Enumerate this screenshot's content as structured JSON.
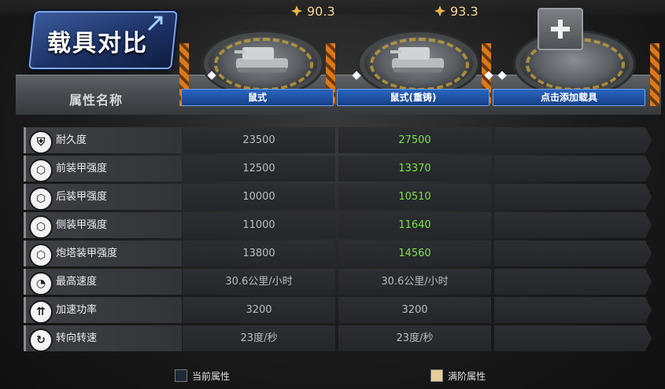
{
  "title": "载具对比",
  "header": {
    "attr_label": "属性名称"
  },
  "slots": [
    {
      "name": "鼠式",
      "rating": "90.3"
    },
    {
      "name": "鼠式(重铸)",
      "rating": "93.3"
    },
    {
      "name": "点击添加载具"
    }
  ],
  "rows": [
    {
      "icon": "durability-icon",
      "label": "耐久度",
      "current": "23500",
      "max": "27500"
    },
    {
      "icon": "armor-front-icon",
      "label": "前装甲强度",
      "current": "12500",
      "max": "13370"
    },
    {
      "icon": "armor-rear-icon",
      "label": "后装甲强度",
      "current": "10000",
      "max": "10510"
    },
    {
      "icon": "armor-side-icon",
      "label": "侧装甲强度",
      "current": "11000",
      "max": "11640"
    },
    {
      "icon": "armor-turret-icon",
      "label": "炮塔装甲强度",
      "current": "13800",
      "max": "14560"
    },
    {
      "icon": "speedometer-icon",
      "label": "最高速度",
      "current": "30.6公里/小时",
      "max": "30.6公里/小时"
    },
    {
      "icon": "acceleration-icon",
      "label": "加速功率",
      "current": "3200",
      "max": "3200"
    },
    {
      "icon": "turn-rate-icon",
      "label": "转向转速",
      "current": "23度/秒",
      "max": "23度/秒"
    }
  ],
  "legend": {
    "current_label": "当前属性",
    "max_label": "满阶属性"
  },
  "colors": {
    "accent_blue": "#2a66c2",
    "upgrade_green": "#7ee04a",
    "rating_gold": "#f2d59a",
    "stripe_orange": "#d9791c"
  }
}
